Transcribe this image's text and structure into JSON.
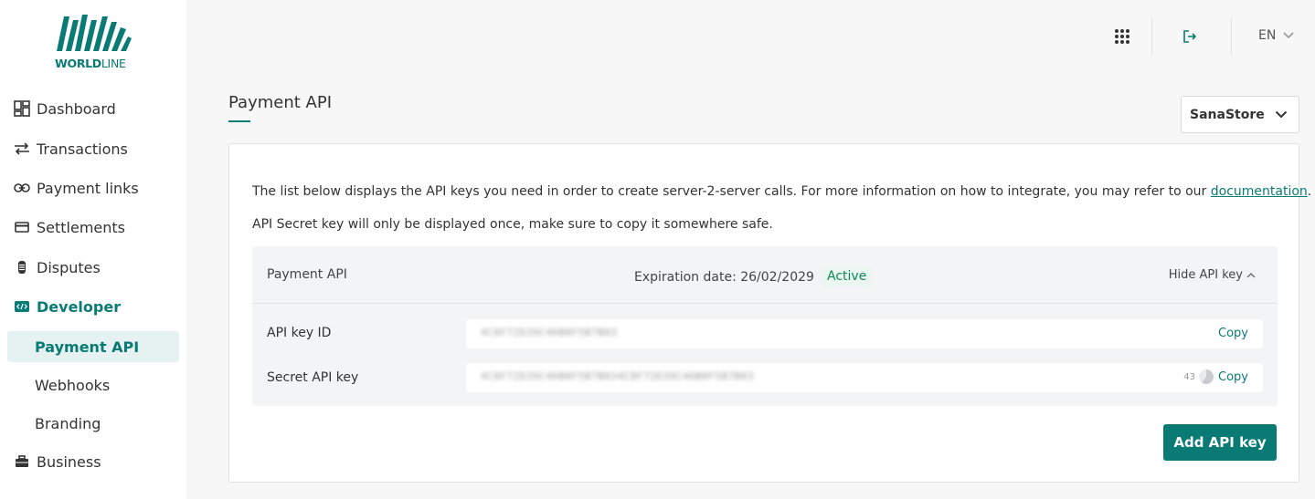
{
  "brand": {
    "logo_bold": "WORLD",
    "logo_light": "LINE",
    "accent": "#0a7b74"
  },
  "topbar": {
    "apps_icon": "grid-icon",
    "logout_icon": "logout-icon",
    "language": "EN"
  },
  "sidebar": {
    "items": [
      {
        "label": "Dashboard",
        "icon": "dashboard-icon"
      },
      {
        "label": "Transactions",
        "icon": "transfer-arrows-icon"
      },
      {
        "label": "Payment links",
        "icon": "link-icon"
      },
      {
        "label": "Settlements",
        "icon": "card-icon"
      },
      {
        "label": "Disputes",
        "icon": "dispute-icon"
      },
      {
        "label": "Developer",
        "icon": "code-icon"
      },
      {
        "label": "Business",
        "icon": "briefcase-icon"
      }
    ],
    "developer_sub": [
      {
        "label": "Payment API",
        "active": true
      },
      {
        "label": "Webhooks",
        "active": false
      },
      {
        "label": "Branding",
        "active": false
      }
    ]
  },
  "page": {
    "title": "Payment API",
    "store": "SanaStore"
  },
  "card": {
    "info_text": "The list below displays the API keys you need in order to create server-2-server calls. For more information on how to integrate, you may refer to our ",
    "info_link": "documentation",
    "info_end": ".",
    "warning": "API Secret key will only be displayed once, make sure to copy it somewhere safe.",
    "api": {
      "name": "Payment API",
      "expiration": "Expiration date: 26/02/2029",
      "status": "Active",
      "hide_label": "Hide API key",
      "keys": [
        {
          "label": "API key ID",
          "value": "4C8F72D39C46B0F5B7B03",
          "copy": "Copy"
        },
        {
          "label": "Secret API key",
          "value": "4C8F72D39C46B0F5B7B034C8F72D39C46B0F5B7B03",
          "copy": "Copy",
          "timer": "43"
        }
      ]
    },
    "add_button": "Add API key"
  }
}
